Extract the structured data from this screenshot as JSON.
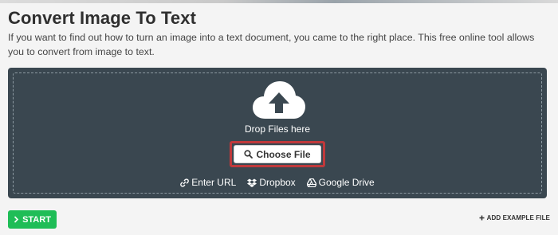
{
  "page": {
    "title": "Convert Image To Text",
    "description": "If you want to find out how to turn an image into a text document, you came to the right place. This free online tool allows you to convert from image to text."
  },
  "upload": {
    "drop_text": "Drop Files here",
    "choose_label": "Choose File",
    "sources": [
      {
        "label": "Enter URL",
        "icon": "link-icon"
      },
      {
        "label": "Dropbox",
        "icon": "dropbox-icon"
      },
      {
        "label": "Google Drive",
        "icon": "google-drive-icon"
      }
    ]
  },
  "actions": {
    "start_label": "START",
    "example_label": "ADD EXAMPLE FILE"
  },
  "colors": {
    "panel": "#3a4750",
    "start": "#1fbd57",
    "highlight": "#c0393b"
  }
}
